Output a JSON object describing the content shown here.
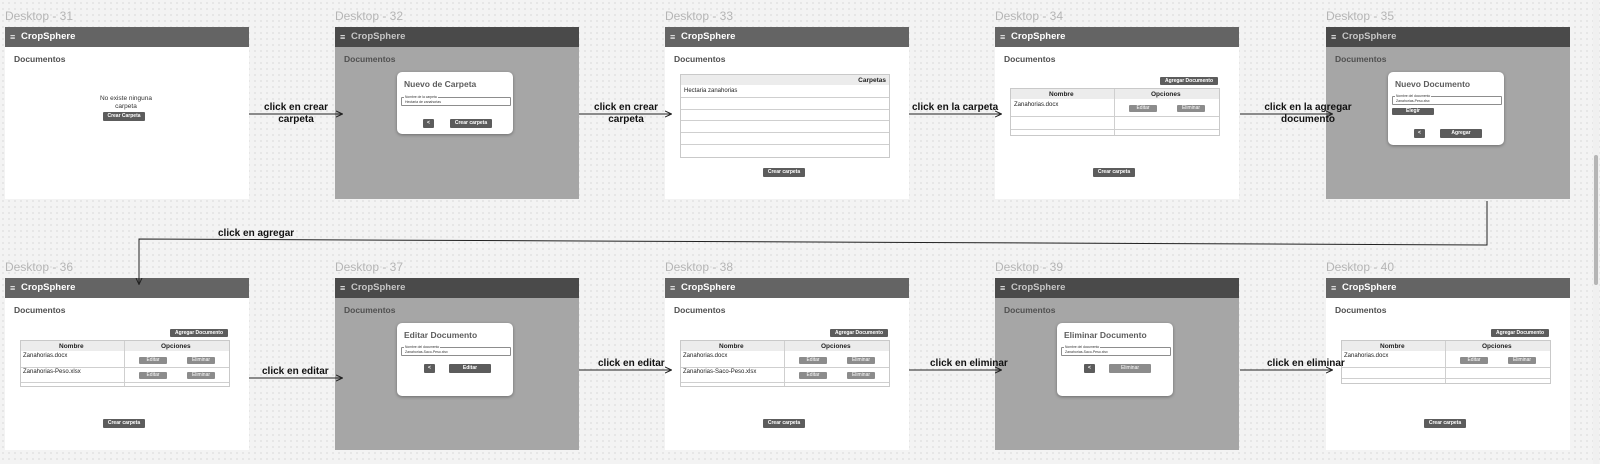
{
  "app_name": "CropSphere",
  "section_title": "Documentos",
  "frames": [
    {
      "label": "Desktop - 31"
    },
    {
      "label": "Desktop - 32"
    },
    {
      "label": "Desktop - 33"
    },
    {
      "label": "Desktop - 34"
    },
    {
      "label": "Desktop - 35"
    },
    {
      "label": "Desktop - 36"
    },
    {
      "label": "Desktop - 37"
    },
    {
      "label": "Desktop - 38"
    },
    {
      "label": "Desktop - 39"
    },
    {
      "label": "Desktop - 40"
    }
  ],
  "empty_state": {
    "message": "No existe ninguna carpeta",
    "button": "Crear Carpeta"
  },
  "create_folder_modal": {
    "title": "Nuevo de Carpeta",
    "field_label": "Nombre de la carpeta",
    "field_value": "Hectaria de zanahorias",
    "back": "<",
    "confirm": "Crear carpeta"
  },
  "folders_table": {
    "header": "Carpetas",
    "rows": [
      "Hectaria zanahorias"
    ]
  },
  "create_folder_button": "Crear carpeta",
  "add_document_button": "Agregar Documento",
  "docs_table": {
    "col_name": "Nombre",
    "col_options": "Opciones",
    "edit": "Editar",
    "delete": "Eliminar"
  },
  "docs_one": [
    "Zanahorias.docx"
  ],
  "docs_two_a": [
    "Zanahorias.docx",
    "Zanahorias-Peso.xlsx"
  ],
  "docs_two_b": [
    "Zanahorias.docx",
    "Zanahorias-Saco-Peso.xlsx"
  ],
  "new_doc_modal": {
    "title": "Nuevo Documento",
    "field_label": "Nombre del documento",
    "field_value": "Zanahorias-Peso.xlsx",
    "choose": "Elegir Documento",
    "back": "<",
    "confirm": "Agregar"
  },
  "edit_doc_modal": {
    "title": "Editar Documento",
    "field_label": "Nombre del documento",
    "field_value": "Zanahorias-Saco-Peso.xlsx",
    "back": "<",
    "confirm": "Editar"
  },
  "delete_doc_modal": {
    "title": "Eliminar Documento",
    "field_label": "Nombre del documento",
    "field_value": "Zanahorias-Saco-Peso.xlsx",
    "back": "<",
    "confirm": "Eliminar"
  },
  "arrows": {
    "a1": "click en crear carpeta",
    "a2": "click en crear carpeta",
    "a3": "click en la carpeta",
    "a4": "click en la agregar documento",
    "a5": "click en agregar",
    "a6": "click en editar",
    "a7": "click en editar",
    "a8": "click en eliminar",
    "a9": "click en eliminar"
  }
}
